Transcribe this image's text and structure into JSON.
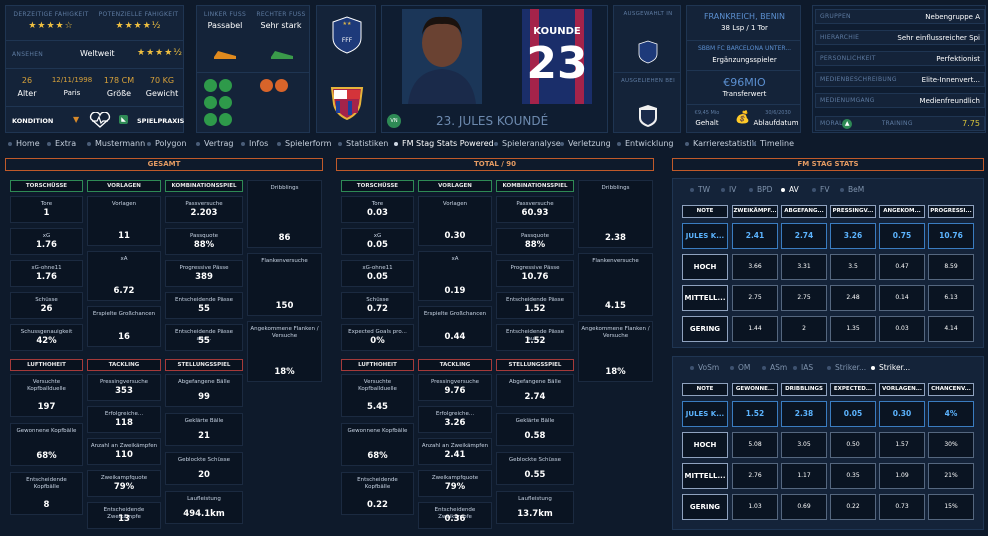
{
  "profile": {
    "current_ability_label": "Derzeitige Fähigkeit",
    "current_ability_stars": "★★★★☆",
    "potential_label": "Potenzielle Fähigkeit",
    "potential_stars": "★★★★½",
    "reputation_label": "Ansehen",
    "reputation_value": "Weltweit",
    "reputation_stars": "★★★★½",
    "age": "26",
    "age_label": "Alter",
    "birth_date": "12/11/1998",
    "birth_place": "Paris",
    "height": "178 CM",
    "height_label": "Größe",
    "weight": "70 KG",
    "weight_label": "Gewicht",
    "condition_label": "KONDITION",
    "match_practice_label": "SPIELPRAXIS",
    "left_foot_label": "Linker Fuß",
    "left_foot_value": "Passabel",
    "right_foot_label": "Rechter Fuß",
    "right_foot_value": "Sehr stark",
    "player_name": "23. JULES KOUNDÉ",
    "shirt_name": "KOUNDE",
    "shirt_number": "23",
    "position_badge": "VN",
    "called_up_label": "Ausgewählt in",
    "loaned_label": "Ausgeliehen bei",
    "nation": "FRANKREICH, BENIN",
    "nation_stats": "38 Lsp / 1 Tor",
    "club_role": "SBBM FC BARCELONA UNTER...",
    "club_role_value": "Ergänzungsspieler",
    "value": "€96MIO",
    "value_label": "Transferwert",
    "wage_hint": "€9,45 Mio",
    "wage_label": "Gehalt",
    "expiry_hint": "30/6/2030",
    "expiry_label": "Ablaufdatum",
    "info_rows": [
      {
        "label": "Gruppen",
        "value": "Nebengruppe A"
      },
      {
        "label": "Hierarchie",
        "value": "Sehr einflussreicher Spi"
      },
      {
        "label": "Persönlichkeit",
        "value": "Perfektionist"
      },
      {
        "label": "Medienbeschreibung",
        "value": "Elite-Innenvert..."
      },
      {
        "label": "Medienumgang",
        "value": "Medienfreundlich"
      }
    ],
    "morale_label": "MORAL",
    "training_label": "TRAINING",
    "training_value": "7.75",
    "colors": {
      "accent": "#c05a2a",
      "green": "#2e8a55",
      "highlight": "#5cb4ff"
    }
  },
  "tabs": [
    "Home",
    "Extra",
    "Mustermann",
    "Polygon",
    "Vertrag",
    "Infos",
    "Spielerform",
    "Statistiken",
    "FM Stag Stats Powered",
    "Spieleranalyse",
    "Verletzung",
    "Entwicklung",
    "Karrierestatistik",
    "Timeline"
  ],
  "active_tab": "FM Stag Stats Powered",
  "panels": [
    {
      "title": "GESAMT",
      "groups": [
        {
          "title": "TORSCHÜSSE",
          "items": [
            {
              "l": "Tore",
              "v": "1"
            },
            {
              "l": "xG",
              "v": "1.76"
            },
            {
              "l": "xG-ohne11",
              "v": "1.76"
            },
            {
              "l": "Schüsse",
              "v": "26"
            },
            {
              "l": "Schussgenauigkeit",
              "v": "42%"
            }
          ]
        },
        {
          "title": "VORLAGEN",
          "items": [
            {
              "l": "Vorlagen",
              "v": "11"
            },
            {
              "l": "xA",
              "v": "6.72"
            },
            {
              "l": "Erspielte Großchancen",
              "v": "16"
            }
          ]
        },
        {
          "title": "KOMBINATIONSSPIEL",
          "items": [
            {
              "l": "Passversuche",
              "v": "2.203"
            },
            {
              "l": "Passquote",
              "v": "88%"
            },
            {
              "l": "Progressive Pässe",
              "v": "389"
            },
            {
              "l": "Entscheidende Pässe",
              "v": "55"
            },
            {
              "l": "Entscheidende Pässe aus...",
              "v": "55"
            }
          ]
        },
        {
          "title": "",
          "items": [
            {
              "l": "Dribblings",
              "v": "86"
            },
            {
              "l": "Flankenversuche",
              "v": "150"
            },
            {
              "l": "Angekommene Flanken / Versuche",
              "v": "18%"
            }
          ]
        },
        {
          "title": "LUFTHOHEIT",
          "items": [
            {
              "l": "Versuchte Kopfballduelle",
              "v": "197"
            },
            {
              "l": "Gewonnene Kopfbälle",
              "v": "68%"
            },
            {
              "l": "Entscheidende Kopfbälle",
              "v": "8"
            }
          ]
        },
        {
          "title": "TACKLING",
          "items": [
            {
              "l": "Pressingversuche",
              "v": "353"
            },
            {
              "l": "Erfolgreiche...",
              "v": "118"
            },
            {
              "l": "Anzahl an Zweikämpfen",
              "v": "110"
            },
            {
              "l": "Zweikampfquote",
              "v": "79%"
            },
            {
              "l": "Entscheidende Zweikämpfe",
              "v": "13"
            }
          ]
        },
        {
          "title": "STELLUNGSSPIEL",
          "items": [
            {
              "l": "Abgefangene Bälle",
              "v": "99"
            },
            {
              "l": "Geklärte Bälle",
              "v": "21"
            },
            {
              "l": "Geblockte Schüsse",
              "v": "20"
            },
            {
              "l": "Laufleistung",
              "v": "494.1km"
            }
          ]
        }
      ]
    },
    {
      "title": "TOTAL / 90",
      "groups": [
        {
          "title": "TORSCHÜSSE",
          "items": [
            {
              "l": "Tore",
              "v": "0.03"
            },
            {
              "l": "xG",
              "v": "0.05"
            },
            {
              "l": "xG-ohne11",
              "v": "0.05"
            },
            {
              "l": "Schüsse",
              "v": "0.72"
            },
            {
              "l": "Expected Goals pro...",
              "v": "0%"
            }
          ]
        },
        {
          "title": "VORLAGEN",
          "items": [
            {
              "l": "Vorlagen",
              "v": "0.30"
            },
            {
              "l": "xA",
              "v": "0.19"
            },
            {
              "l": "Erspielte Großchancen",
              "v": "0.44"
            }
          ]
        },
        {
          "title": "KOMBINATIONSSPIEL",
          "items": [
            {
              "l": "Passversuche",
              "v": "60.93"
            },
            {
              "l": "Passquote",
              "v": "88%"
            },
            {
              "l": "Progressive Pässe",
              "v": "10.76"
            },
            {
              "l": "Entscheidende Pässe",
              "v": "1.52"
            },
            {
              "l": "Entscheidende Pässe aus...",
              "v": "1.52"
            }
          ]
        },
        {
          "title": "",
          "items": [
            {
              "l": "Dribblings",
              "v": "2.38"
            },
            {
              "l": "Flankenversuche",
              "v": "4.15"
            },
            {
              "l": "Angekommene Flanken / Versuche",
              "v": "18%"
            }
          ]
        },
        {
          "title": "LUFTHOHEIT",
          "items": [
            {
              "l": "Versuchte Kopfballduelle",
              "v": "5.45"
            },
            {
              "l": "Gewonnene Kopfbälle",
              "v": "68%"
            },
            {
              "l": "Entscheidende Kopfbälle",
              "v": "0.22"
            }
          ]
        },
        {
          "title": "TACKLING",
          "items": [
            {
              "l": "Pressingversuche",
              "v": "9.76"
            },
            {
              "l": "Erfolgreiche...",
              "v": "3.26"
            },
            {
              "l": "Anzahl an Zweikämpfen",
              "v": "2.41"
            },
            {
              "l": "Zweikampfquote",
              "v": "79%"
            },
            {
              "l": "Entscheidende Zweikämpfe",
              "v": "0.36"
            }
          ]
        },
        {
          "title": "STELLUNGSSPIEL",
          "items": [
            {
              "l": "Abgefangene Bälle",
              "v": "2.74"
            },
            {
              "l": "Geklärte Bälle",
              "v": "0.58"
            },
            {
              "l": "Geblockte Schüsse",
              "v": "0.55"
            },
            {
              "l": "Laufleistung",
              "v": "13.7km"
            }
          ]
        }
      ]
    }
  ],
  "stag": {
    "title": "FM STAG STATS",
    "tables": [
      {
        "tabs": [
          "TW",
          "IV",
          "BPD",
          "AV",
          "FV",
          "BeM"
        ],
        "active": "AV",
        "headers": [
          "NOTE",
          "ZWEIKÄMPF...",
          "ABGEFANG...",
          "PRESSINGV...",
          "ANGEKOM...",
          "PROGRESSI..."
        ],
        "rows": [
          {
            "label": "JULES K...",
            "values": [
              "2.41",
              "2.74",
              "3.26",
              "0.75",
              "10.76"
            ]
          },
          {
            "label": "HOCH",
            "values": [
              "3.66",
              "3.31",
              "3.5",
              "0.47",
              "8.59"
            ]
          },
          {
            "label": "MITTELL...",
            "values": [
              "2.75",
              "2.75",
              "2.48",
              "0.14",
              "6.13"
            ]
          },
          {
            "label": "GERING",
            "values": [
              "1.44",
              "2",
              "1.35",
              "0.03",
              "4.14"
            ]
          }
        ]
      },
      {
        "tabs": [
          "VoSm",
          "OM",
          "ASm",
          "IAS",
          "Striker...",
          "Striker..."
        ],
        "active_index": 5,
        "headers": [
          "NOTE",
          "GEWONNE...",
          "DRIBBLINGS",
          "EXPECTED...",
          "VORLAGEN...",
          "CHANCENV..."
        ],
        "rows": [
          {
            "label": "JULES K...",
            "values": [
              "1.52",
              "2.38",
              "0.05",
              "0.30",
              "4%"
            ]
          },
          {
            "label": "HOCH",
            "values": [
              "5.08",
              "3.05",
              "0.50",
              "1.57",
              "30%"
            ]
          },
          {
            "label": "MITTELL...",
            "values": [
              "2.76",
              "1.17",
              "0.35",
              "1.09",
              "21%"
            ]
          },
          {
            "label": "GERING",
            "values": [
              "1.03",
              "0.69",
              "0.22",
              "0.73",
              "15%"
            ]
          }
        ]
      }
    ]
  }
}
